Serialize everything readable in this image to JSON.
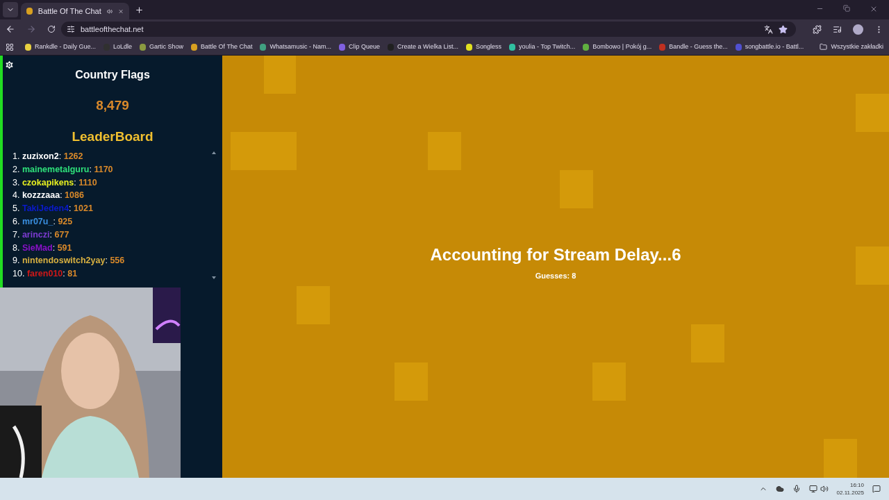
{
  "tabs": [
    {
      "title": "Battle Of The Chat",
      "selected": true,
      "audible": true
    }
  ],
  "address": {
    "url": "battleofthechat.net"
  },
  "bookmarks": [
    {
      "label": "Rankdle - Daily Gue...",
      "color": "#e8d040"
    },
    {
      "label": "LoLdle",
      "color": "#303030"
    },
    {
      "label": "Gartic Show",
      "color": "#8a9a40"
    },
    {
      "label": "Battle Of The Chat",
      "color": "#d8a020"
    },
    {
      "label": "Whatsamusic - Nam...",
      "color": "#40a080"
    },
    {
      "label": "Clip Queue",
      "color": "#8060e0"
    },
    {
      "label": "Create a Wielka List...",
      "color": "#202020"
    },
    {
      "label": "Songless",
      "color": "#e0e020"
    },
    {
      "label": "youlia - Top Twitch...",
      "color": "#30c0a0"
    },
    {
      "label": "Bombowo | Pokój g...",
      "color": "#60b040"
    },
    {
      "label": "Bandle - Guess the...",
      "color": "#c03020"
    },
    {
      "label": "songbattle.io - Battl...",
      "color": "#5050d0"
    }
  ],
  "all_bookmarks": "Wszystkie zakładki",
  "sidebar": {
    "category": "Country Flags",
    "count": "8,479",
    "leaderboard_title": "LeaderBoard",
    "entries": [
      {
        "rank": "1.",
        "name": "zuzixon2",
        "separator": ":",
        "score": "1262",
        "color": "#ffffff"
      },
      {
        "rank": "2.",
        "name": "mainemetalguru",
        "separator": ":",
        "score": "1170",
        "color": "#2ee07a"
      },
      {
        "rank": "3.",
        "name": "czokapikens",
        "separator": ":",
        "score": "1110",
        "color": "#e8f020"
      },
      {
        "rank": "4.",
        "name": "kozzzaaa",
        "separator": ":",
        "score": "1086",
        "color": "#ffffff"
      },
      {
        "rank": "5.",
        "name": "TakiJeden4",
        "separator": ":",
        "score": "1021",
        "color": "#0a1acc"
      },
      {
        "rank": "6.",
        "name": "mr07u_",
        "separator": ":",
        "score": "925",
        "color": "#3a8fe0"
      },
      {
        "rank": "7.",
        "name": "arinczi",
        "separator": ":",
        "score": "677",
        "color": "#7b3bd0"
      },
      {
        "rank": "8.",
        "name": "SieMad",
        "separator": ":",
        "score": "591",
        "color": "#8a10c8"
      },
      {
        "rank": "9.",
        "name": "nintendoswitch2yay",
        "separator": ":",
        "score": "556",
        "color": "#d8b040"
      },
      {
        "rank": "10.",
        "name": "faren010",
        "separator": ":",
        "score": "81",
        "color": "#d01818"
      }
    ]
  },
  "game": {
    "status": "Accounting for Stream Delay...6",
    "guesses": "Guesses: 8"
  },
  "taskbar": {
    "time": "16:10",
    "date": "02.11.2025"
  }
}
